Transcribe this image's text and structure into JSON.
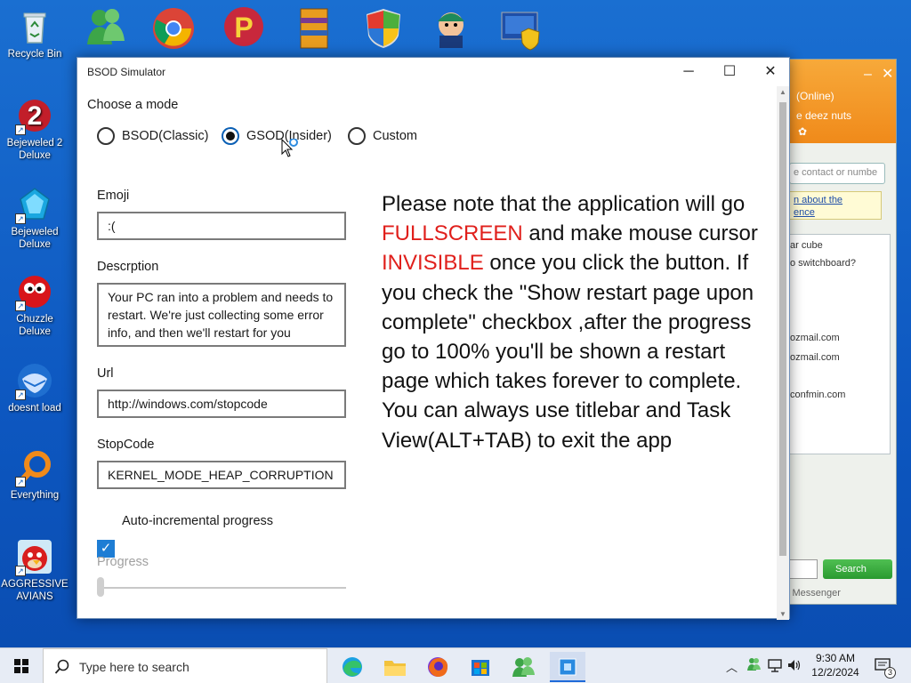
{
  "desktop": {
    "icons": [
      {
        "label": "Recycle Bin",
        "icon": "recycle-bin-icon"
      },
      {
        "label": "Bejeweled 2 Deluxe",
        "icon": "bejeweled-2-icon"
      },
      {
        "label": "Bejeweled Deluxe",
        "icon": "bejeweled-icon"
      },
      {
        "label": "Chuzzle Deluxe",
        "icon": "chuzzle-icon"
      },
      {
        "label": "doesnt load",
        "icon": "thunderbird-icon"
      },
      {
        "label": "Everything",
        "icon": "everything-search-icon"
      },
      {
        "label": "AGGRESSIVE AVIANS",
        "icon": "angry-bird-icon"
      }
    ],
    "top_icons": [
      "msn-messenger-icon",
      "chrome-icon",
      "pinball-icon",
      "winrar-icon",
      "windows-security-icon",
      "game-character-icon",
      "control-panel-icon"
    ]
  },
  "messenger": {
    "status": "(Online)",
    "personal_message": "e deez nuts",
    "search_placeholder": "e contact or numbe",
    "notice_line1": "n about the",
    "notice_line2": "ence",
    "items": [
      "ar cube",
      "o switchboard?",
      "ozmail.com",
      "ozmail.com",
      "confmin.com"
    ],
    "search_button": "Search",
    "footer": "l Messenger"
  },
  "window": {
    "title": "BSOD Simulator",
    "choose_mode_label": "Choose a mode",
    "modes": [
      {
        "label": "BSOD(Classic)",
        "selected": false
      },
      {
        "label": "GSOD(Insider)",
        "selected": true
      },
      {
        "label": "Custom",
        "selected": false
      }
    ],
    "emoji_label": "Emoji",
    "emoji_value": ":(",
    "description_label": "Descrption",
    "description_value": "Your PC ran into a problem and needs to restart. We're just collecting some error info, and then we'll restart for you",
    "url_label": "Url",
    "url_value": "http://windows.com/stopcode",
    "stopcode_label": "StopCode",
    "stopcode_value": "KERNEL_MODE_HEAP_CORRUPTION",
    "auto_progress_label": "Auto-incremental progress",
    "auto_progress_checked": true,
    "progress_label": "Progress",
    "progress_value": 0,
    "note": {
      "p1": "Please note that the application will go",
      "fullscreen": "FULLSCREEN",
      "p2": "and make mouse cursor",
      "invisible": "INVISIBLE",
      "p3": "once you click the button. If you check the \"Show restart page upon complete\" checkbox ,after the progress go to 100% you'll be shown a restart page which takes forever to complete. You can always use titlebar and Task View(ALT+TAB) to exit the app"
    }
  },
  "taskbar": {
    "search_placeholder": "Type here to search",
    "apps": [
      "edge-icon",
      "file-explorer-icon",
      "firefox-icon",
      "store-icon",
      "messenger-icon",
      "bsod-simulator-icon"
    ],
    "time": "9:30 AM",
    "date": "12/2/2024",
    "notification_count": "3"
  },
  "colors": {
    "accent": "#0a5fb4",
    "warning_red": "#e0201c",
    "desktop_blue": "#0d57c0"
  }
}
